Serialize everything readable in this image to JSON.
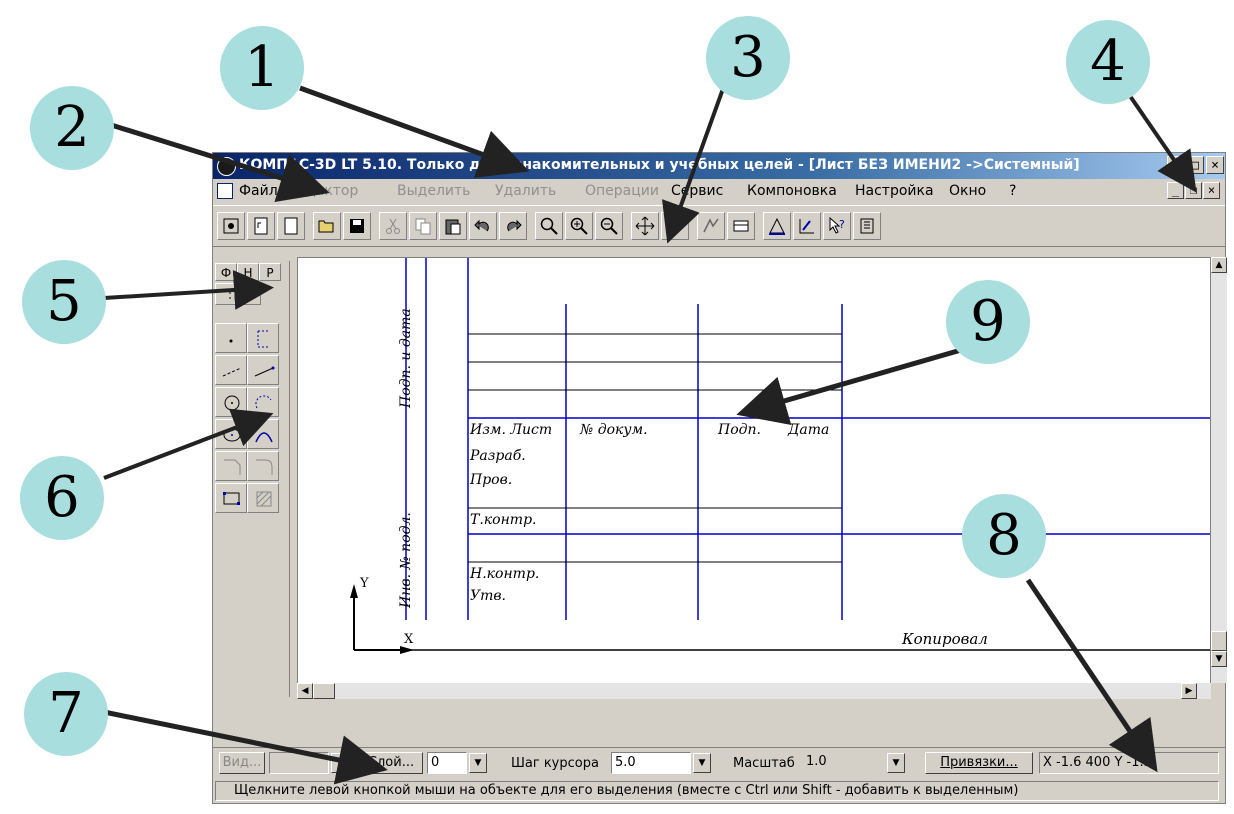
{
  "window": {
    "title": "КОМПАС-3D LT 5.10. Только для ознакомительных и учебных целей - [Лист БЕЗ ИМЕНИ2 ->Системный]",
    "min": "_",
    "max": "□",
    "close": "×"
  },
  "menu": {
    "items": [
      {
        "label": "Файл",
        "disabled": false
      },
      {
        "label": "Редактор",
        "disabled": true
      },
      {
        "label": "Выделить",
        "disabled": true
      },
      {
        "label": "Удалить",
        "disabled": true
      },
      {
        "label": "Операции",
        "disabled": true
      },
      {
        "label": "Сервис",
        "disabled": false
      },
      {
        "label": "Компоновка",
        "disabled": false
      },
      {
        "label": "Настройка",
        "disabled": false
      },
      {
        "label": "Окно",
        "disabled": false
      },
      {
        "label": "?",
        "disabled": false
      }
    ]
  },
  "left_panel": {
    "tabs": [
      "Ф",
      "Н",
      "Р"
    ]
  },
  "stamp": {
    "vertical_top": "Подп. и дата",
    "vertical_bottom": "Инв. № подл.",
    "izm_list": "Изм. Лист",
    "n_dokum": "№ докум.",
    "podp": "Подп.",
    "data": "Дата",
    "razrab": "Разраб.",
    "prov": "Пров.",
    "tkontr": "Т.контр.",
    "nkontr": "Н.контр.",
    "utv": "Утв.",
    "kopiroval": "Копировал",
    "axis_x": "X",
    "axis_y": "Y"
  },
  "status": {
    "vid_btn": "Вид...",
    "sloi_btn": "Слой...",
    "sloi_value": "0",
    "shag_label": "Шаг курсора",
    "shag_value": "5.0",
    "masshtab_label": "Масштаб",
    "masshtab_value": "1.0",
    "privyazki_btn": "Привязки...",
    "coords": "X -1.6 400 Y -1.5",
    "hint": "Щелкните левой кнопкой мыши на объекте для его выделения (вместе с Ctrl или Shift - добавить к выделенным)"
  },
  "callouts": [
    "1",
    "2",
    "3",
    "4",
    "5",
    "6",
    "7",
    "8",
    "9"
  ]
}
